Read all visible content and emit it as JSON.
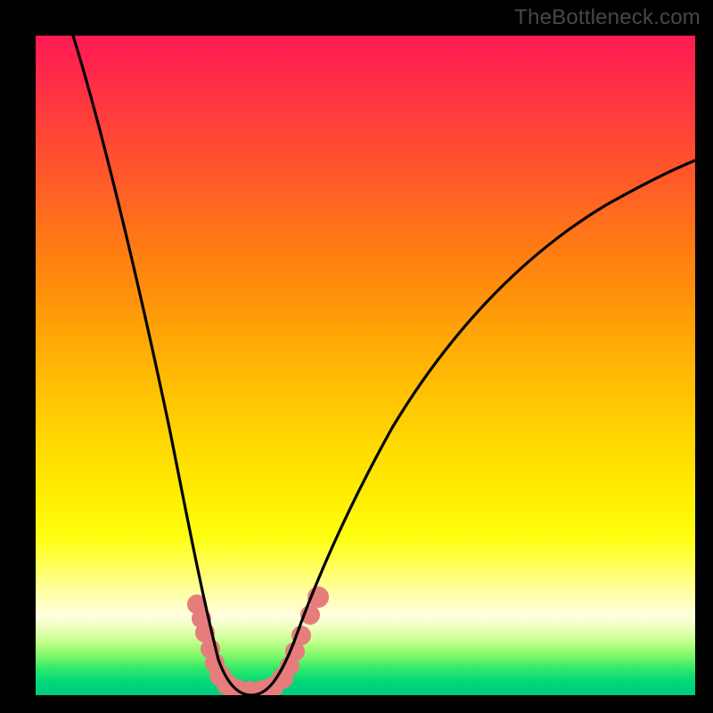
{
  "watermark": {
    "text": "TheBottleneck.com"
  },
  "chart_data": {
    "type": "line",
    "title": "",
    "xlabel": "",
    "ylabel": "",
    "xlim": [
      0,
      100
    ],
    "ylim": [
      0,
      100
    ],
    "grid": false,
    "background": "gradient-red-yellow-green",
    "curve_shape": "downward-V-notch",
    "series": [
      {
        "name": "curve",
        "x": [
          6,
          8,
          10,
          12,
          14,
          16,
          18,
          20,
          22,
          24,
          25,
          26,
          27,
          28,
          29,
          30,
          31,
          33,
          36,
          40,
          45,
          50,
          55,
          60,
          65,
          70,
          75,
          80,
          85,
          90,
          95,
          100
        ],
        "y": [
          100,
          93,
          85,
          77,
          69,
          60,
          51,
          42,
          33,
          22,
          15,
          9,
          4,
          1,
          0,
          0,
          1,
          4,
          10,
          18,
          28,
          36,
          44,
          51,
          57,
          62,
          67,
          71,
          75,
          78,
          81,
          83
        ]
      }
    ],
    "highlight_region": {
      "description": "salmon-pink dotted cluster at curve trough",
      "approx_x_range": [
        23,
        33
      ],
      "approx_y_range": [
        0,
        14
      ]
    }
  }
}
